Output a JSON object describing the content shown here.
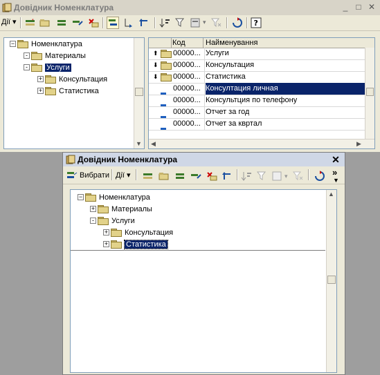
{
  "main_window": {
    "title": "Довідник Номенклатура",
    "actions_label": "Дії",
    "tree": {
      "root": "Номенклатура",
      "items": [
        {
          "label": "Материалы",
          "level": 1,
          "expander": "-"
        },
        {
          "label": "Услуги",
          "level": 1,
          "expander": "-",
          "selected": true
        },
        {
          "label": "Консультация",
          "level": 2,
          "expander": "+"
        },
        {
          "label": "Статистика",
          "level": 2,
          "expander": "+"
        }
      ]
    },
    "grid": {
      "columns": [
        "Код",
        "Найменування"
      ],
      "rows": [
        {
          "marker": "up",
          "kind": "folder",
          "code": "00000...",
          "name": "Услуги"
        },
        {
          "marker": "down",
          "kind": "folder",
          "code": "00000...",
          "name": "Консультация"
        },
        {
          "marker": "down",
          "kind": "folder",
          "code": "00000...",
          "name": "Статистика"
        },
        {
          "marker": "",
          "kind": "item",
          "code": "00000...",
          "name": "Консултация личная",
          "selected": true
        },
        {
          "marker": "",
          "kind": "item",
          "code": "00000...",
          "name": "Консультция по телефону"
        },
        {
          "marker": "",
          "kind": "item",
          "code": "00000...",
          "name": "Отчет за год"
        },
        {
          "marker": "",
          "kind": "item",
          "code": "00000...",
          "name": "Отчет за квртал"
        }
      ]
    }
  },
  "select_window": {
    "title": "Довідник Номенклатура",
    "select_label": "Вибрати",
    "actions_label": "Дії",
    "more_label": "»",
    "tree": {
      "root": "Номенклатура",
      "items": [
        {
          "label": "Материалы",
          "level": 1,
          "expander": "+"
        },
        {
          "label": "Услуги",
          "level": 1,
          "expander": "-"
        },
        {
          "label": "Консультация",
          "level": 2,
          "expander": "+"
        },
        {
          "label": "Статистика",
          "level": 2,
          "expander": "+",
          "selected": true
        }
      ]
    }
  },
  "icons": {
    "minimize": "_",
    "maximize": "□",
    "close": "✕"
  },
  "colors": {
    "selection": "#0a246a",
    "window_bg": "#ece9d8",
    "desktop": "#9e9e9e"
  }
}
